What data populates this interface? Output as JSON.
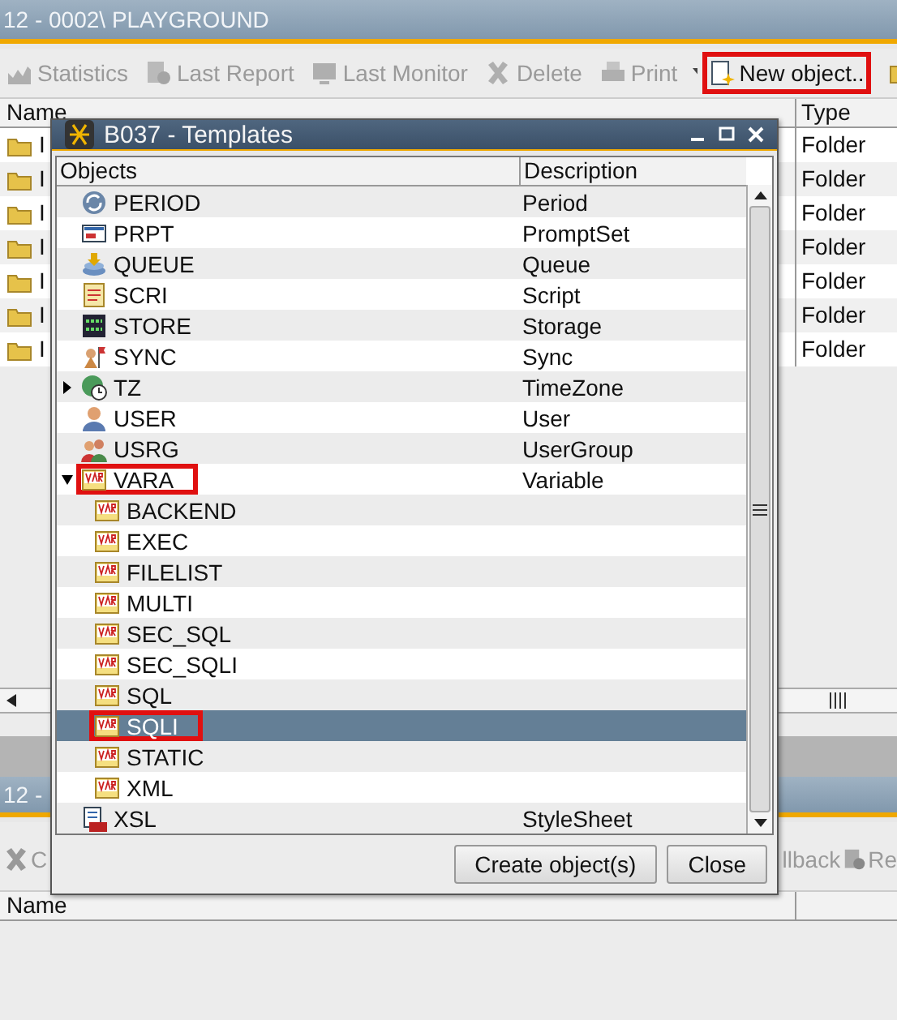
{
  "window": {
    "title": "12 - 0002\\ PLAYGROUND"
  },
  "toolbar": [
    {
      "label": "Statistics",
      "kind": "chart",
      "disabled": true,
      "highlighted": false
    },
    {
      "label": "Last Report",
      "kind": "report",
      "disabled": true,
      "highlighted": false
    },
    {
      "label": "Last Monitor",
      "kind": "monitor",
      "disabled": true,
      "highlighted": false
    },
    {
      "label": "Delete",
      "kind": "delete",
      "disabled": true,
      "highlighted": false
    },
    {
      "label": "Print",
      "kind": "print",
      "disabled": true,
      "highlighted": false
    },
    {
      "label": "New object..",
      "kind": "new",
      "disabled": false,
      "highlighted": true
    }
  ],
  "table": {
    "columns": [
      "Name",
      "Type"
    ],
    "rows": [
      {
        "name": "I",
        "type": "Folder"
      },
      {
        "name": "I",
        "type": "Folder"
      },
      {
        "name": "I",
        "type": "Folder"
      },
      {
        "name": "I",
        "type": "Folder"
      },
      {
        "name": "I",
        "type": "Folder"
      },
      {
        "name": "I",
        "type": "Folder"
      },
      {
        "name": "I",
        "type": "Folder"
      }
    ]
  },
  "lower_pane": {
    "title": "12 -",
    "toolbar": [
      {
        "label": "C",
        "kind": "delete"
      },
      {
        "label": "llback",
        "kind": "none"
      },
      {
        "label": "Re",
        "kind": "report"
      }
    ],
    "columns": [
      "Name"
    ]
  },
  "dialog": {
    "title": "B037 - Templates",
    "columns": [
      "Objects",
      "Description"
    ],
    "items": [
      {
        "name": "PERIOD",
        "description": "Period",
        "kind": "period",
        "selected": false,
        "highlighted": false
      },
      {
        "name": "PRPT",
        "description": "PromptSet",
        "kind": "prompt",
        "selected": false,
        "highlighted": false
      },
      {
        "name": "QUEUE",
        "description": "Queue",
        "kind": "queue",
        "selected": false,
        "highlighted": false
      },
      {
        "name": "SCRI",
        "description": "Script",
        "kind": "script",
        "selected": false,
        "highlighted": false
      },
      {
        "name": "STORE",
        "description": "Storage",
        "kind": "store",
        "selected": false,
        "highlighted": false
      },
      {
        "name": "SYNC",
        "description": "Sync",
        "kind": "sync",
        "selected": false,
        "highlighted": false
      },
      {
        "name": "TZ",
        "description": "TimeZone",
        "kind": "timezone",
        "selected": false,
        "highlighted": false,
        "expanded": false
      },
      {
        "name": "USER",
        "description": "User",
        "kind": "user",
        "selected": false,
        "highlighted": false
      },
      {
        "name": "USRG",
        "description": "UserGroup",
        "kind": "usergroup",
        "selected": false,
        "highlighted": false
      },
      {
        "name": "VARA",
        "description": "Variable",
        "kind": "variable",
        "selected": false,
        "highlighted": true,
        "expanded": true,
        "children": [
          {
            "name": "BACKEND",
            "kind": "variable",
            "selected": false,
            "highlighted": false
          },
          {
            "name": "EXEC",
            "kind": "variable",
            "selected": false,
            "highlighted": false
          },
          {
            "name": "FILELIST",
            "kind": "variable",
            "selected": false,
            "highlighted": false
          },
          {
            "name": "MULTI",
            "kind": "variable",
            "selected": false,
            "highlighted": false
          },
          {
            "name": "SEC_SQL",
            "kind": "variable",
            "selected": false,
            "highlighted": false
          },
          {
            "name": "SEC_SQLI",
            "kind": "variable",
            "selected": false,
            "highlighted": false
          },
          {
            "name": "SQL",
            "kind": "variable",
            "selected": false,
            "highlighted": false
          },
          {
            "name": "SQLI",
            "kind": "variable",
            "selected": true,
            "highlighted": true
          },
          {
            "name": "STATIC",
            "kind": "variable",
            "selected": false,
            "highlighted": false
          },
          {
            "name": "XML",
            "kind": "variable",
            "selected": false,
            "highlighted": false
          }
        ]
      },
      {
        "name": "XSL",
        "description": "StyleSheet",
        "kind": "stylesheet",
        "selected": false,
        "highlighted": false
      }
    ],
    "buttons": [
      "Create object(s)",
      "Close"
    ]
  }
}
